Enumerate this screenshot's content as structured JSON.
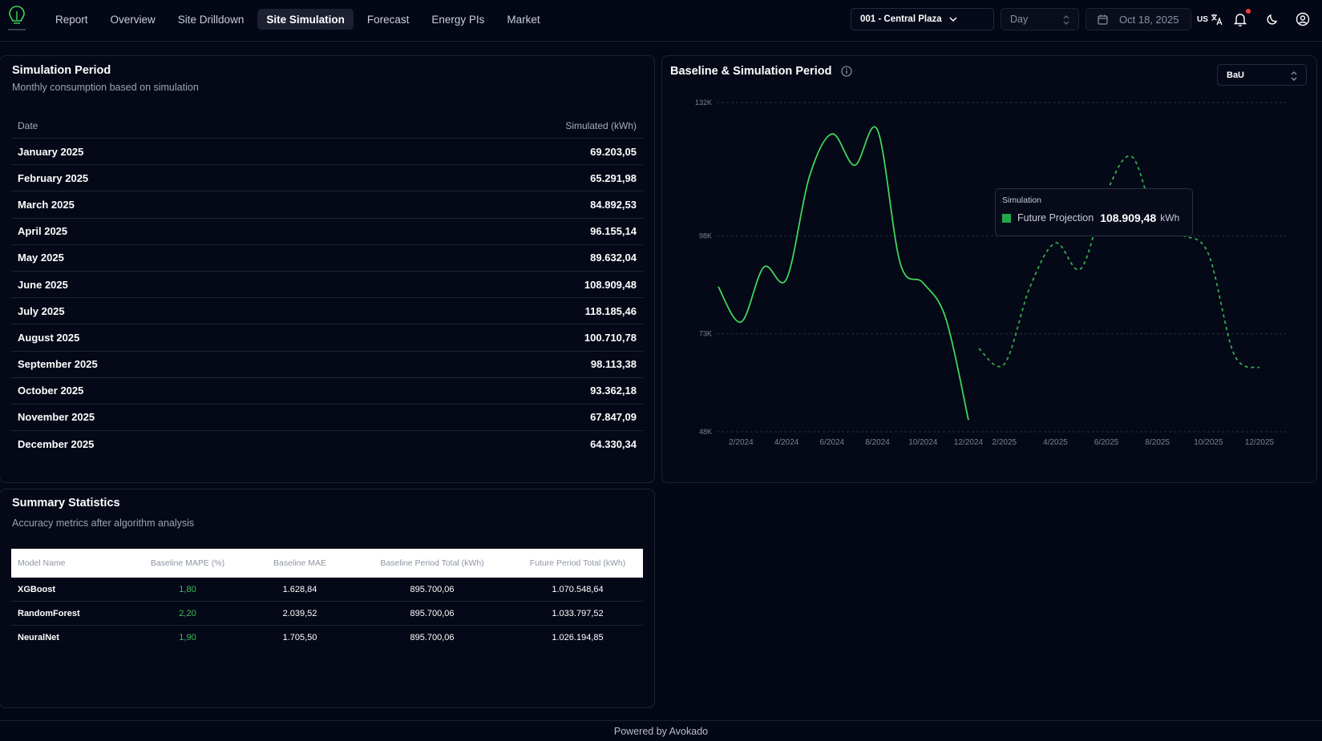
{
  "nav": {
    "items": [
      {
        "label": "Report",
        "active": false
      },
      {
        "label": "Overview",
        "active": false
      },
      {
        "label": "Site Drilldown",
        "active": false
      },
      {
        "label": "Site Simulation",
        "active": true
      },
      {
        "label": "Forecast",
        "active": false
      },
      {
        "label": "Energy PIs",
        "active": false
      },
      {
        "label": "Market",
        "active": false
      }
    ],
    "site": "001 - Central Plaza",
    "granularity": "Day",
    "date": "Oct 18, 2025",
    "language": "US",
    "icons": {
      "logo": "bulb-logo-icon",
      "calendar": "calendar-icon",
      "translate": "translate-icon",
      "bell": "bell-icon",
      "theme": "moon-icon",
      "account": "user-circle-icon"
    }
  },
  "simulation": {
    "title": "Simulation Period",
    "subtitle": "Monthly consumption based on simulation",
    "headers": {
      "date": "Date",
      "value": "Simulated (kWh)"
    },
    "rows": [
      {
        "date": "January 2025",
        "value": "69.203,05"
      },
      {
        "date": "February 2025",
        "value": "65.291,98"
      },
      {
        "date": "March 2025",
        "value": "84.892,53"
      },
      {
        "date": "April 2025",
        "value": "96.155,14"
      },
      {
        "date": "May 2025",
        "value": "89.632,04"
      },
      {
        "date": "June 2025",
        "value": "108.909,48"
      },
      {
        "date": "July 2025",
        "value": "118.185,46"
      },
      {
        "date": "August 2025",
        "value": "100.710,78"
      },
      {
        "date": "September 2025",
        "value": "98.113,38"
      },
      {
        "date": "October 2025",
        "value": "93.362,18"
      },
      {
        "date": "November 2025",
        "value": "67.847,09"
      },
      {
        "date": "December 2025",
        "value": "64.330,34"
      }
    ]
  },
  "summary": {
    "title": "Summary Statistics",
    "subtitle": "Accuracy metrics after algorithm analysis",
    "headers": [
      "Model Name",
      "Baseline MAPE (%)",
      "Baseline MAE",
      "Baseline Period Total (kWh)",
      "Future Period Total (kWh)"
    ],
    "rows": [
      {
        "model": "XGBoost",
        "mape": "1,80",
        "mae": "1.628,84",
        "baseline_total": "895.700,06",
        "future_total": "1.070.548,64"
      },
      {
        "model": "RandomForest",
        "mape": "2,20",
        "mae": "2.039,52",
        "baseline_total": "895.700,06",
        "future_total": "1.033.797,52"
      },
      {
        "model": "NeuralNet",
        "mape": "1,90",
        "mae": "1.705,50",
        "baseline_total": "895.700,06",
        "future_total": "1.026.194,85"
      }
    ]
  },
  "chart_panel": {
    "title": "Baseline & Simulation Period",
    "scenario": "BaU",
    "tooltip": {
      "label": "Simulation",
      "series": "Future Projection",
      "value": "108.909,48",
      "unit": "kWh"
    }
  },
  "chart_data": {
    "type": "line",
    "title": "",
    "xlabel": "",
    "ylabel": "",
    "ylim": [
      48000,
      132000
    ],
    "y_ticks": [
      "132K",
      "98K",
      "73K",
      "48K"
    ],
    "grid": true,
    "series": [
      {
        "name": "",
        "style": "solid",
        "color": "#3fd65a",
        "x_ticks": [
          "2/2024",
          "4/2024",
          "6/2024",
          "8/2024",
          "10/2024",
          "12/2024"
        ],
        "points": [
          {
            "x": "1/2024",
            "y": 85000
          },
          {
            "x": "2/2024",
            "y": 76000
          },
          {
            "x": "3/2024",
            "y": 90000
          },
          {
            "x": "4/2024",
            "y": 87000
          },
          {
            "x": "5/2024",
            "y": 113000
          },
          {
            "x": "6/2024",
            "y": 124000
          },
          {
            "x": "7/2024",
            "y": 116000
          },
          {
            "x": "8/2024",
            "y": 125000
          },
          {
            "x": "9/2024",
            "y": 91000
          },
          {
            "x": "10/2024",
            "y": 86000
          },
          {
            "x": "11/2024",
            "y": 77000
          },
          {
            "x": "12/2024",
            "y": 51000
          }
        ]
      },
      {
        "name": "Future Projection",
        "style": "dashed",
        "color": "#2fae4c",
        "x_ticks": [
          "2/2025",
          "4/2025",
          "6/2025",
          "8/2025",
          "10/2025",
          "12/2025"
        ],
        "points": [
          {
            "x": "1/2025",
            "y": 69203.05
          },
          {
            "x": "2/2025",
            "y": 65291.98
          },
          {
            "x": "3/2025",
            "y": 84892.53
          },
          {
            "x": "4/2025",
            "y": 96155.14
          },
          {
            "x": "5/2025",
            "y": 89632.04
          },
          {
            "x": "6/2025",
            "y": 108909.48
          },
          {
            "x": "7/2025",
            "y": 118185.46
          },
          {
            "x": "8/2025",
            "y": 100710.78
          },
          {
            "x": "9/2025",
            "y": 98113.38
          },
          {
            "x": "10/2025",
            "y": 93362.18
          },
          {
            "x": "11/2025",
            "y": 67847.09
          },
          {
            "x": "12/2025",
            "y": 64330.34
          }
        ]
      }
    ]
  },
  "footer": {
    "text": "Powered by Avokado"
  }
}
